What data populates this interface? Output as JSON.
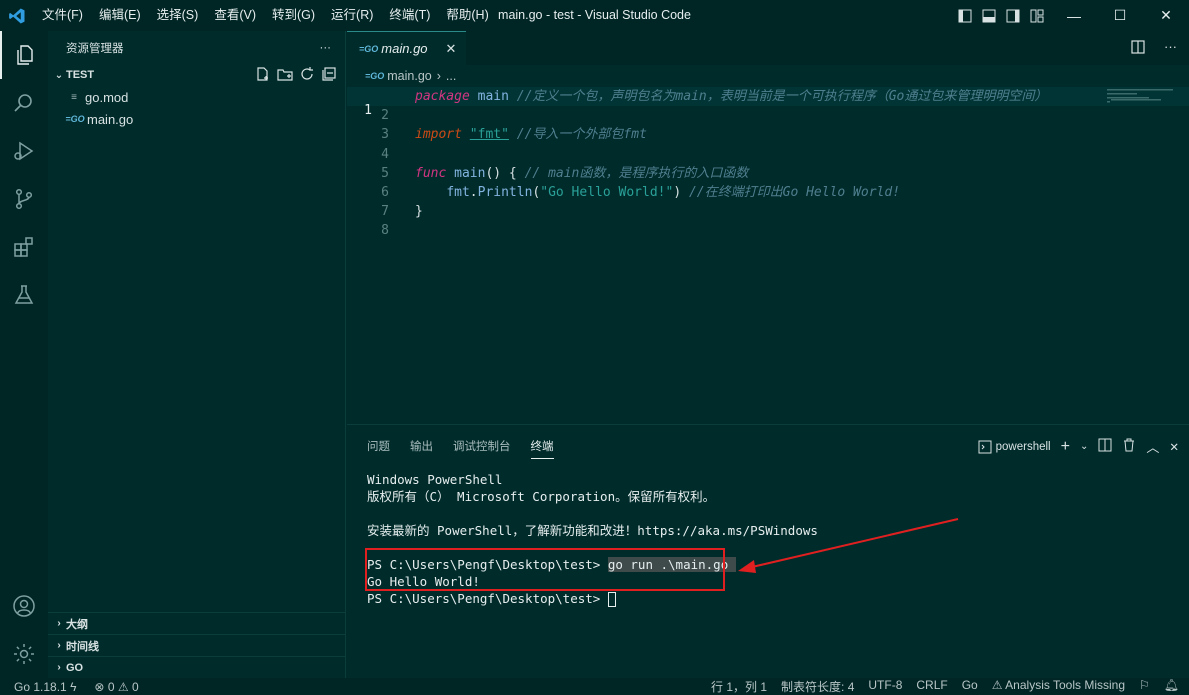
{
  "window": {
    "title": "main.go - test - Visual Studio Code",
    "menu": [
      "文件(F)",
      "编辑(E)",
      "选择(S)",
      "查看(V)",
      "转到(G)",
      "运行(R)",
      "终端(T)",
      "帮助(H)"
    ],
    "controls": {
      "minimize": "—",
      "maximize": "☐",
      "close": "✕"
    }
  },
  "sidebar": {
    "header": "资源管理器",
    "more": "···",
    "folder": "TEST",
    "files": [
      {
        "name": "go.mod",
        "icon": "lines-icon"
      },
      {
        "name": "main.go",
        "icon": "go-icon"
      }
    ],
    "bottom_sections": [
      "大纲",
      "时间线",
      "GO"
    ]
  },
  "editor": {
    "tab": {
      "label": "main.go",
      "close": "✕",
      "go_badge": "GO"
    },
    "breadcrumb": {
      "file": "main.go",
      "sep": "›",
      "rest": "..."
    },
    "line_numbers": [
      "1",
      "2",
      "3",
      "4",
      "5",
      "6",
      "7",
      "8"
    ],
    "code": {
      "l1_kw": "package",
      "l1_name": " main",
      "l1_comment": " //定义一个包，声明包名为main，表明当前是一个可执行程序（Go通过包来管理明明空间）",
      "l3_kw": "import",
      "l3_str": "\"fmt\"",
      "l3_comment": " //导入一个外部包fmt",
      "l5_kw": "func",
      "l5_fn": " main",
      "l5_rest": "() {",
      "l5_comment": " // main函数，是程序执行的入口函数",
      "l6_indent": "    ",
      "l6_pkg": "fmt",
      "l6_dot": ".",
      "l6_fn": "Println",
      "l6_open": "(",
      "l6_str": "\"Go Hello World!\"",
      "l6_close": ")",
      "l6_comment": " //在终端打印出Go Hello World!",
      "l7": "}"
    }
  },
  "panel": {
    "tabs": [
      "问题",
      "输出",
      "调试控制台",
      "终端"
    ],
    "active_tab": "终端",
    "shell": "powershell",
    "terminal": {
      "l1": "Windows PowerShell",
      "l2": "版权所有（C） Microsoft Corporation。保留所有权利。",
      "l4": "安装最新的 PowerShell，了解新功能和改进！https://aka.ms/PSWindows",
      "prompt": "PS C:\\Users\\Pengf\\Desktop\\test> ",
      "command": "go run .\\main.go ",
      "output": "Go Hello World!"
    }
  },
  "statusbar": {
    "go_version": "Go 1.18.1",
    "errors": "0",
    "warnings": "0",
    "position": "行 1，列 1",
    "tab_size": "制表符长度: 4",
    "encoding": "UTF-8",
    "eol": "CRLF",
    "language": "Go",
    "analysis": "Analysis Tools Missing"
  },
  "colors": {
    "accent": "#0078d4",
    "annotation": "#e02020",
    "background": "#002b2b"
  }
}
